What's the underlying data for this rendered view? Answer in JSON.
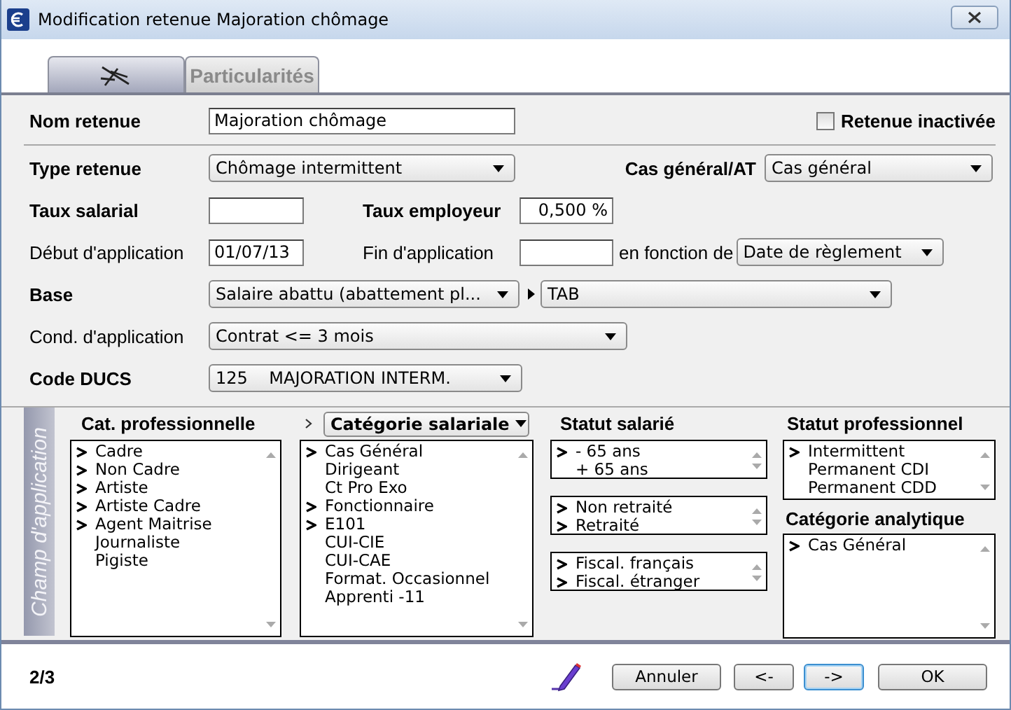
{
  "window": {
    "title": "Modification retenue Majoration chômage"
  },
  "tabs": [
    {
      "kind": "icon",
      "selected": true
    },
    {
      "kind": "text",
      "label": "Particularités",
      "selected": false
    }
  ],
  "form": {
    "nom_retenue": {
      "label": "Nom retenue",
      "value": "Majoration chômage"
    },
    "retenue_inactivee": {
      "label": "Retenue inactivée",
      "checked": false
    },
    "type_retenue": {
      "label": "Type retenue",
      "value": "Chômage intermittent"
    },
    "cas_general_at": {
      "label": "Cas général/AT",
      "value": "Cas général"
    },
    "taux_salarial": {
      "label": "Taux salarial"
    },
    "taux_employeur": {
      "label": "Taux employeur",
      "value": "0,500 %"
    },
    "debut_application": {
      "label": "Début d'application",
      "value": "01/07/13"
    },
    "fin_application": {
      "label": "Fin d'application"
    },
    "en_fonction_de": {
      "label": "en fonction de",
      "value": "Date de règlement"
    },
    "base": {
      "label": "Base",
      "value": "Salaire abattu (abattement pl...",
      "value_2": "TAB"
    },
    "cond_application": {
      "label": "Cond. d'application",
      "value": "Contrat <= 3 mois"
    },
    "code_ducs": {
      "label": "Code DUCS",
      "value": "125    MAJORATION INTERM."
    }
  },
  "champ_application": {
    "title": "Champ d'application",
    "cat_professionnelle": {
      "title": "Cat. professionnelle",
      "items": [
        {
          "label": "Cadre",
          "selected": true
        },
        {
          "label": "Non Cadre",
          "selected": true
        },
        {
          "label": "Artiste",
          "selected": true
        },
        {
          "label": "Artiste Cadre",
          "selected": true
        },
        {
          "label": "Agent Maitrise",
          "selected": true
        },
        {
          "label": "Journaliste",
          "selected": false
        },
        {
          "label": "Pigiste",
          "selected": false
        }
      ]
    },
    "categorie_salariale": {
      "value": "Catégorie salariale",
      "items": [
        {
          "label": "Cas Général",
          "selected": true
        },
        {
          "label": "Dirigeant",
          "selected": false
        },
        {
          "label": "Ct Pro Exo",
          "selected": false
        },
        {
          "label": "Fonctionnaire",
          "selected": true
        },
        {
          "label": "E101",
          "selected": true
        },
        {
          "label": "CUI-CIE",
          "selected": false
        },
        {
          "label": "CUI-CAE",
          "selected": false
        },
        {
          "label": "Format. Occasionnel",
          "selected": false
        },
        {
          "label": "Apprenti -11",
          "selected": false
        }
      ]
    },
    "statut_salarie": {
      "title": "Statut salarié",
      "lists": [
        [
          {
            "label": "- 65 ans",
            "selected": true
          },
          {
            "label": "+ 65 ans",
            "selected": false
          }
        ],
        [
          {
            "label": "Non retraité",
            "selected": true
          },
          {
            "label": "Retraité",
            "selected": true
          }
        ],
        [
          {
            "label": "Fiscal. français",
            "selected": true
          },
          {
            "label": "Fiscal. étranger",
            "selected": true
          }
        ]
      ]
    },
    "statut_professionnel": {
      "title": "Statut professionnel",
      "items": [
        {
          "label": "Intermittent",
          "selected": true
        },
        {
          "label": "Permanent CDI",
          "selected": false
        },
        {
          "label": "Permanent CDD",
          "selected": false
        }
      ]
    },
    "categorie_analytique": {
      "title": "Catégorie analytique",
      "items": [
        {
          "label": "Cas Général",
          "selected": true
        }
      ]
    }
  },
  "footer": {
    "page": "2/3",
    "buttons": [
      {
        "label": "Annuler",
        "default": false
      },
      {
        "label": "<-",
        "default": false
      },
      {
        "label": "->",
        "default": true
      },
      {
        "label": "OK",
        "default": false
      }
    ]
  }
}
